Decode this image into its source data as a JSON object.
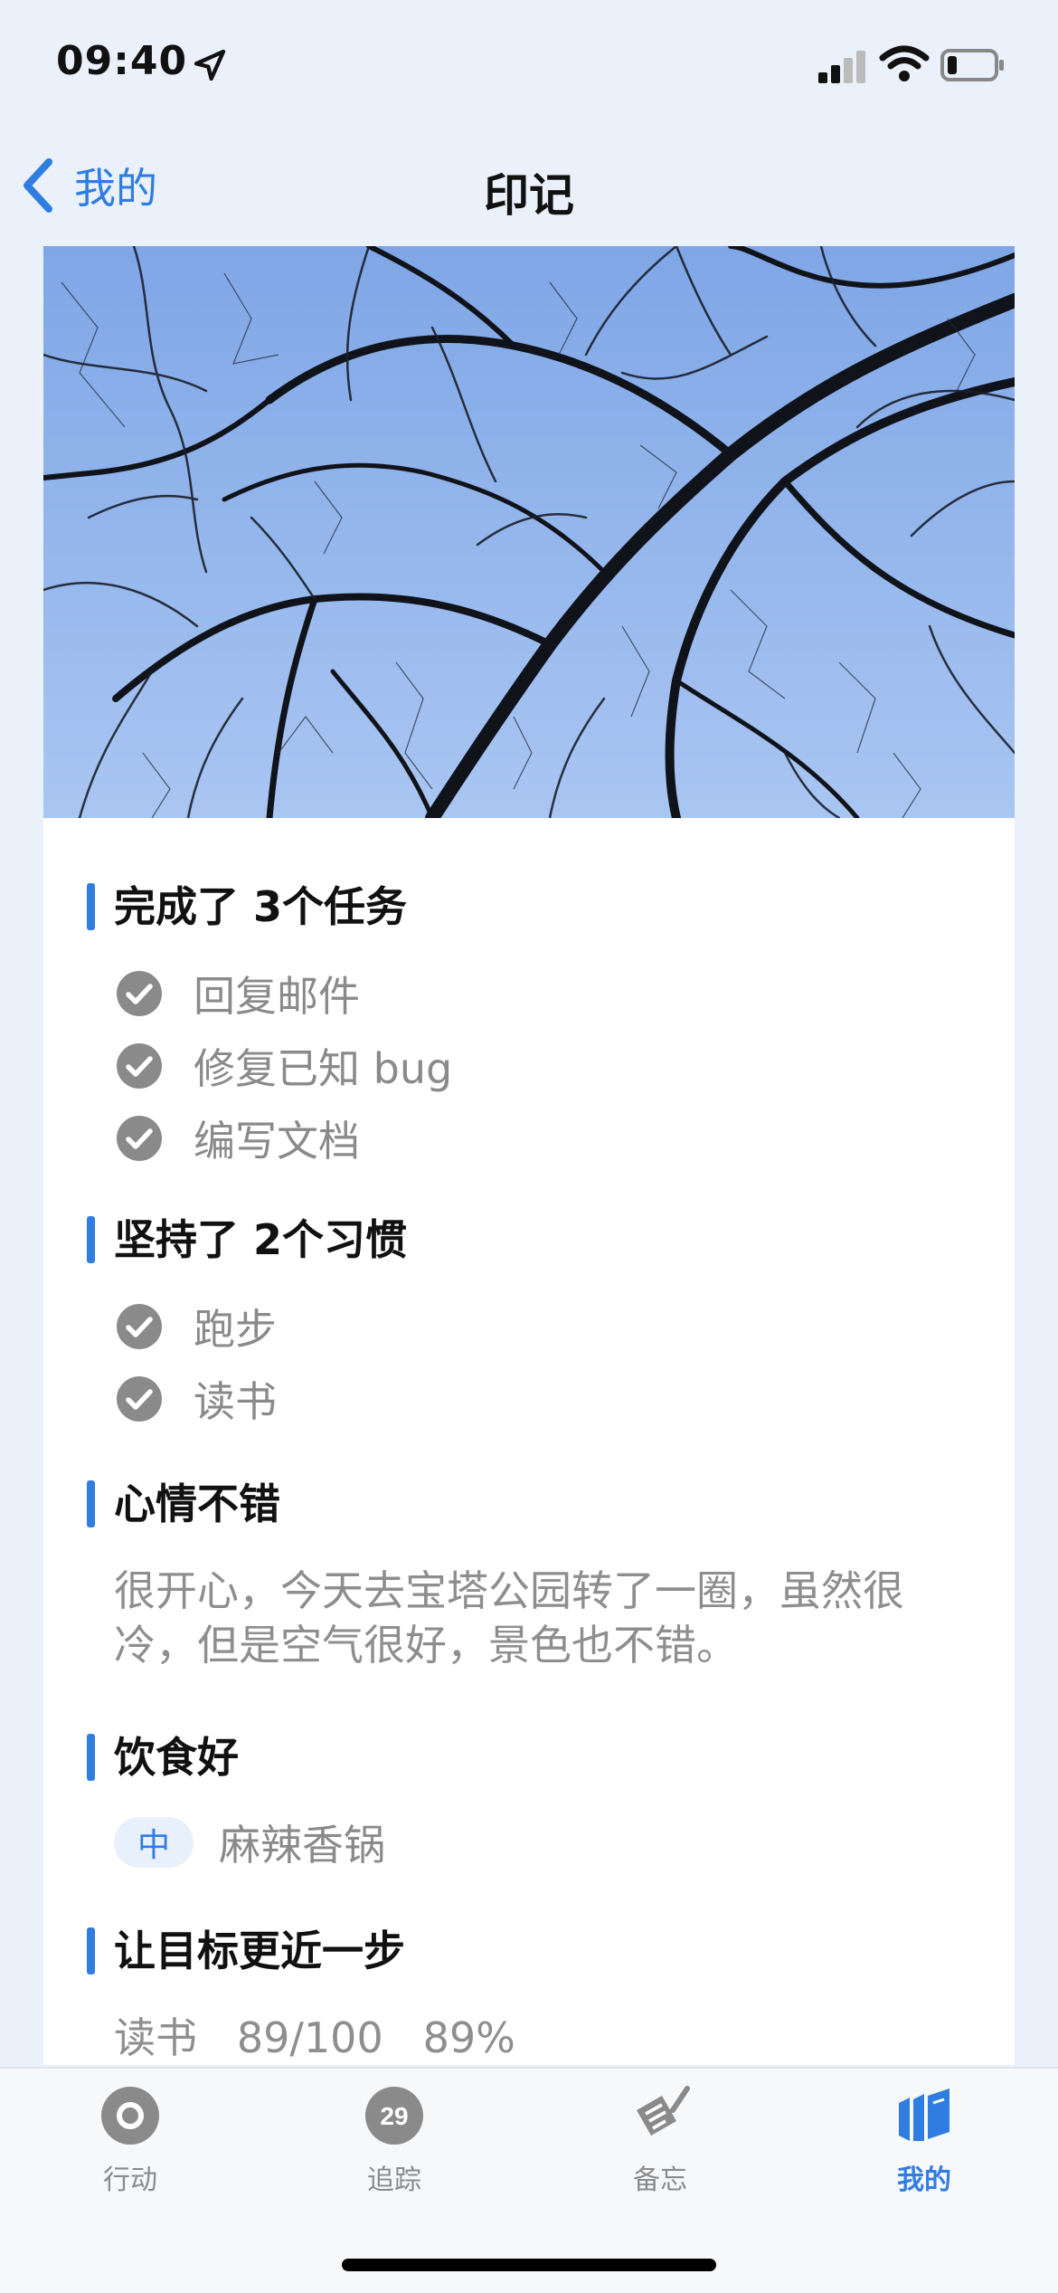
{
  "status_bar": {
    "time": "09:40"
  },
  "nav": {
    "back_label": "我的",
    "title": "印记"
  },
  "sections": {
    "tasks": {
      "title": "完成了 3个任务",
      "items": [
        "回复邮件",
        "修复已知 bug",
        "编写文档"
      ]
    },
    "habits": {
      "title": "坚持了 2个习惯",
      "items": [
        "跑步",
        "读书"
      ]
    },
    "mood": {
      "title": "心情不错",
      "note": "很开心，今天去宝塔公园转了一圈，虽然很冷，但是空气很好，景色也不错。"
    },
    "food": {
      "title": "饮食好",
      "badge": "中",
      "dish": "麻辣香锅"
    },
    "goal": {
      "title": "让目标更近一步",
      "name": "读书",
      "progress_text": "89/100",
      "percent_text": "89%",
      "progress_fraction": 0.89
    }
  },
  "tabbar": {
    "tabs": [
      {
        "label": "行动",
        "icon": "target-icon"
      },
      {
        "label": "追踪",
        "icon": "calendar-badge-icon",
        "badge": "29"
      },
      {
        "label": "备忘",
        "icon": "note-pencil-icon"
      },
      {
        "label": "我的",
        "icon": "books-icon",
        "active": true
      }
    ]
  },
  "colors": {
    "accent": "#2f7de1",
    "background": "#eaf1fb",
    "check": "#8a8a8a"
  }
}
